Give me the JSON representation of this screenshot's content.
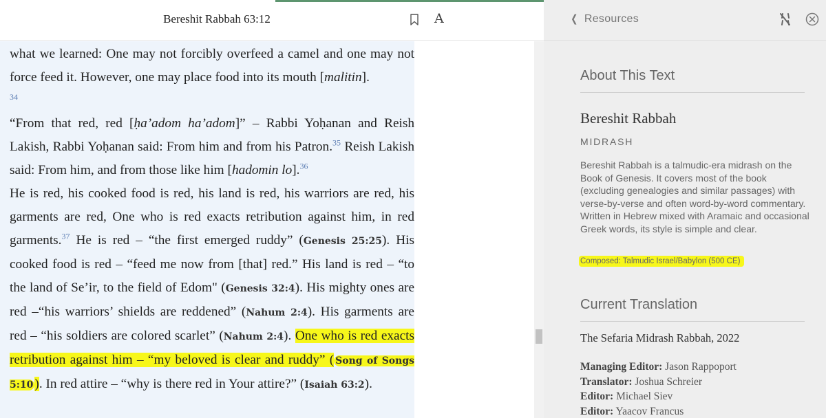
{
  "reader": {
    "title": "Bereshit Rabbah 63:12",
    "bookmark_icon": "bookmark-icon",
    "font_button_label": "A",
    "paragraphs": {
      "p1": {
        "text": "what we learned: One may not forcibly overfeed a camel and one may not force feed it. However, one may place food into its mouth [",
        "italic": "malitin",
        "end": "].",
        "footnote": "34"
      },
      "p2": {
        "a": "“From that red, red [",
        "a_it": "ḥa’adom ha’adom",
        "b": "]” – Rabbi Yoḥanan and Reish Lakish, Rabbi Yoḥanan said: From him and from his Patron.",
        "fn1": "35",
        "c": " Reish Lakish said: From him, and from those like him [",
        "c_it": "hadomin lo",
        "d": "].",
        "fn2": "36"
      },
      "p3": {
        "a": "He is red, his cooked food is red, his land is red, his warriors are red, his garments are red, One who is red exacts retribution against him, in red garments.",
        "fn": "37",
        "b": " He is red – “the first emerged ruddy” (",
        "ref1": "Genesis 25:25",
        "c": "). His cooked food is red – “feed me now from [that] red.” His land is red – “to the land of Se’ir, to the field of Edom\" (",
        "ref2": "Genesis 32:4",
        "d": "). His mighty ones are red –“his warriors’ shields are reddened” (",
        "ref3": "Nahum 2:4",
        "e": "). His garments are red – “his soldiers are colored scarlet” (",
        "ref4": "Nahum 2:4",
        "f": "). ",
        "hl1": "One who is red exacts retribution against him – “my beloved is clear and ruddy” (",
        "ref5": "Song of Songs 5:10",
        "hl2": ")",
        "g": ". In red attire – “why is there red in Your attire?” (",
        "ref6": "Isaiah 63:2",
        "h": ")."
      }
    }
  },
  "panel": {
    "back_label": "Resources",
    "about_title": "About This Text",
    "book_title": "Bereshit Rabbah",
    "category": "MIDRASH",
    "description": "Bereshit Rabbah is a talmudic-era midrash on the Book of Genesis. It covers most of the book (excluding genealogies and similar passages) with verse-by-verse and often word-by-word commentary. Written in Hebrew mixed with Aramaic and occasional Greek words, its style is simple and clear.",
    "composed": "Composed: Talmudic Israel/Babylon (500 CE)",
    "translation_title": "Current Translation",
    "translation_name": "The Sefaria Midrash Rabbah, 2022",
    "credits": [
      {
        "role": "Managing Editor:",
        "name": " Jason Rappoport"
      },
      {
        "role": "Translator:",
        "name": " Joshua Schreier"
      },
      {
        "role": "Editor:",
        "name": " Michael Siev"
      },
      {
        "role": "Editor:",
        "name": " Yaacov Francus"
      }
    ]
  },
  "colors": {
    "highlight": "#f7f71a",
    "text_column_bg": "#eef4fb",
    "panel_bg": "#eeeeee",
    "footnote_blue": "#5c7db3",
    "accent_green": "#5d956f"
  }
}
